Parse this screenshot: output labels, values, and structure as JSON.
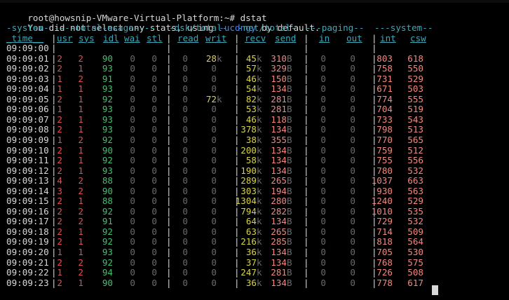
{
  "prompt": {
    "text": "root@howsnip-VMware-Virtual-Platform:~# dstat"
  },
  "notice": {
    "prefix": "You did not select any stats, using ",
    "flag": "-ucdngy",
    "suffix": " by default."
  },
  "group_headers": {
    "system": "-system-",
    "total_usage": "----total-usage----",
    "dsk_total": "-dsk/total-",
    "net_total": "-net/total-",
    "paging": "---paging--",
    "system2": "---system--"
  },
  "columns": {
    "time": "time",
    "usr": "usr",
    "sys": "sys",
    "idl": "idl",
    "wai": "wai",
    "stl": "stl",
    "read": "read",
    "writ": "writ",
    "recv": "recv",
    "send": "send",
    "in": "in",
    "out": "out",
    "int": "int",
    "csw": "csw"
  },
  "rows": [
    {
      "time": "09:09:00",
      "usr": "",
      "sys": "",
      "idl": "",
      "wai": "",
      "stl": "",
      "read": "",
      "writ": "",
      "writ_unit": "",
      "recv": "",
      "recv_unit": "",
      "send": "",
      "send_unit": "",
      "pin": "",
      "pout": "",
      "int": "",
      "csw": ""
    },
    {
      "time": "09:09:01",
      "usr": "2",
      "sys": "2",
      "idl": "90",
      "wai": "0",
      "stl": "0",
      "read": "0",
      "writ": "28",
      "writ_unit": "k",
      "recv": "45",
      "recv_unit": "k",
      "send": "310",
      "send_unit": "B",
      "pin": "0",
      "pout": "0",
      "int": "803",
      "csw": "618"
    },
    {
      "time": "09:09:02",
      "usr": "2",
      "sys": "1",
      "idl": "93",
      "wai": "0",
      "stl": "0",
      "read": "0",
      "writ": "0",
      "writ_unit": "",
      "recv": "57",
      "recv_unit": "k",
      "send": "329",
      "send_unit": "B",
      "pin": "0",
      "pout": "0",
      "int": "758",
      "csw": "550"
    },
    {
      "time": "09:09:03",
      "usr": "1",
      "sys": "2",
      "idl": "91",
      "wai": "0",
      "stl": "0",
      "read": "0",
      "writ": "0",
      "writ_unit": "",
      "recv": "46",
      "recv_unit": "k",
      "send": "150",
      "send_unit": "B",
      "pin": "0",
      "pout": "0",
      "int": "731",
      "csw": "529"
    },
    {
      "time": "09:09:04",
      "usr": "1",
      "sys": "1",
      "idl": "93",
      "wai": "0",
      "stl": "0",
      "read": "0",
      "writ": "0",
      "writ_unit": "",
      "recv": "54",
      "recv_unit": "k",
      "send": "134",
      "send_unit": "B",
      "pin": "0",
      "pout": "0",
      "int": "671",
      "csw": "503"
    },
    {
      "time": "09:09:05",
      "usr": "2",
      "sys": "1",
      "idl": "92",
      "wai": "0",
      "stl": "0",
      "read": "0",
      "writ": "72",
      "writ_unit": "k",
      "recv": "82",
      "recv_unit": "k",
      "send": "281",
      "send_unit": "B",
      "pin": "0",
      "pout": "0",
      "int": "774",
      "csw": "555"
    },
    {
      "time": "09:09:06",
      "usr": "1",
      "sys": "1",
      "idl": "93",
      "wai": "0",
      "stl": "0",
      "read": "0",
      "writ": "0",
      "writ_unit": "",
      "recv": "53",
      "recv_unit": "k",
      "send": "281",
      "send_unit": "B",
      "pin": "0",
      "pout": "0",
      "int": "704",
      "csw": "519"
    },
    {
      "time": "09:09:07",
      "usr": "2",
      "sys": "1",
      "idl": "93",
      "wai": "0",
      "stl": "0",
      "read": "0",
      "writ": "0",
      "writ_unit": "",
      "recv": "46",
      "recv_unit": "k",
      "send": "118",
      "send_unit": "B",
      "pin": "0",
      "pout": "0",
      "int": "733",
      "csw": "543"
    },
    {
      "time": "09:09:08",
      "usr": "2",
      "sys": "1",
      "idl": "93",
      "wai": "0",
      "stl": "0",
      "read": "0",
      "writ": "0",
      "writ_unit": "",
      "recv": "378",
      "recv_unit": "k",
      "send": "134",
      "send_unit": "B",
      "pin": "0",
      "pout": "0",
      "int": "798",
      "csw": "513"
    },
    {
      "time": "09:09:09",
      "usr": "1",
      "sys": "2",
      "idl": "92",
      "wai": "0",
      "stl": "0",
      "read": "0",
      "writ": "0",
      "writ_unit": "",
      "recv": "38",
      "recv_unit": "k",
      "send": "355",
      "send_unit": "B",
      "pin": "0",
      "pout": "0",
      "int": "770",
      "csw": "565"
    },
    {
      "time": "09:09:10",
      "usr": "2",
      "sys": "1",
      "idl": "90",
      "wai": "0",
      "stl": "0",
      "read": "0",
      "writ": "0",
      "writ_unit": "",
      "recv": "200",
      "recv_unit": "k",
      "send": "134",
      "send_unit": "B",
      "pin": "0",
      "pout": "0",
      "int": "759",
      "csw": "512"
    },
    {
      "time": "09:09:11",
      "usr": "2",
      "sys": "1",
      "idl": "92",
      "wai": "0",
      "stl": "0",
      "read": "0",
      "writ": "0",
      "writ_unit": "",
      "recv": "58",
      "recv_unit": "k",
      "send": "134",
      "send_unit": "B",
      "pin": "0",
      "pout": "0",
      "int": "755",
      "csw": "556"
    },
    {
      "time": "09:09:12",
      "usr": "2",
      "sys": "1",
      "idl": "93",
      "wai": "0",
      "stl": "0",
      "read": "0",
      "writ": "0",
      "writ_unit": "",
      "recv": "190",
      "recv_unit": "k",
      "send": "134",
      "send_unit": "B",
      "pin": "0",
      "pout": "0",
      "int": "780",
      "csw": "532"
    },
    {
      "time": "09:09:13",
      "usr": "4",
      "sys": "2",
      "idl": "88",
      "wai": "0",
      "stl": "0",
      "read": "0",
      "writ": "0",
      "writ_unit": "",
      "recv": "289",
      "recv_unit": "k",
      "send": "265",
      "send_unit": "B",
      "pin": "0",
      "pout": "0",
      "int": "1037",
      "csw": "663"
    },
    {
      "time": "09:09:14",
      "usr": "3",
      "sys": "2",
      "idl": "90",
      "wai": "0",
      "stl": "0",
      "read": "0",
      "writ": "0",
      "writ_unit": "",
      "recv": "303",
      "recv_unit": "k",
      "send": "194",
      "send_unit": "B",
      "pin": "0",
      "pout": "0",
      "int": "930",
      "csw": "563"
    },
    {
      "time": "09:09:15",
      "usr": "2",
      "sys": "1",
      "idl": "88",
      "wai": "0",
      "stl": "0",
      "read": "0",
      "writ": "0",
      "writ_unit": "",
      "recv": "1304",
      "recv_unit": "k",
      "send": "280",
      "send_unit": "B",
      "pin": "0",
      "pout": "0",
      "int": "1240",
      "csw": "529"
    },
    {
      "time": "09:09:16",
      "usr": "2",
      "sys": "2",
      "idl": "92",
      "wai": "0",
      "stl": "0",
      "read": "0",
      "writ": "0",
      "writ_unit": "",
      "recv": "794",
      "recv_unit": "k",
      "send": "282",
      "send_unit": "B",
      "pin": "0",
      "pout": "0",
      "int": "1010",
      "csw": "535"
    },
    {
      "time": "09:09:17",
      "usr": "2",
      "sys": "2",
      "idl": "91",
      "wai": "0",
      "stl": "0",
      "read": "0",
      "writ": "0",
      "writ_unit": "",
      "recv": "64",
      "recv_unit": "k",
      "send": "134",
      "send_unit": "B",
      "pin": "0",
      "pout": "0",
      "int": "729",
      "csw": "532"
    },
    {
      "time": "09:09:18",
      "usr": "2",
      "sys": "1",
      "idl": "92",
      "wai": "0",
      "stl": "0",
      "read": "0",
      "writ": "0",
      "writ_unit": "",
      "recv": "63",
      "recv_unit": "k",
      "send": "265",
      "send_unit": "B",
      "pin": "0",
      "pout": "0",
      "int": "714",
      "csw": "509"
    },
    {
      "time": "09:09:19",
      "usr": "2",
      "sys": "1",
      "idl": "92",
      "wai": "0",
      "stl": "0",
      "read": "0",
      "writ": "0",
      "writ_unit": "",
      "recv": "216",
      "recv_unit": "k",
      "send": "285",
      "send_unit": "B",
      "pin": "0",
      "pout": "0",
      "int": "818",
      "csw": "564"
    },
    {
      "time": "09:09:20",
      "usr": "1",
      "sys": "1",
      "idl": "93",
      "wai": "0",
      "stl": "0",
      "read": "0",
      "writ": "0",
      "writ_unit": "",
      "recv": "36",
      "recv_unit": "k",
      "send": "134",
      "send_unit": "B",
      "pin": "0",
      "pout": "0",
      "int": "705",
      "csw": "530"
    },
    {
      "time": "09:09:21",
      "usr": "2",
      "sys": "2",
      "idl": "92",
      "wai": "0",
      "stl": "0",
      "read": "0",
      "writ": "0",
      "writ_unit": "",
      "recv": "37",
      "recv_unit": "k",
      "send": "134",
      "send_unit": "B",
      "pin": "0",
      "pout": "0",
      "int": "768",
      "csw": "575"
    },
    {
      "time": "09:09:22",
      "usr": "1",
      "sys": "2",
      "idl": "94",
      "wai": "0",
      "stl": "0",
      "read": "0",
      "writ": "0",
      "writ_unit": "",
      "recv": "247",
      "recv_unit": "k",
      "send": "281",
      "send_unit": "B",
      "pin": "0",
      "pout": "0",
      "int": "726",
      "csw": "508"
    },
    {
      "time": "09:09:23",
      "usr": "2",
      "sys": "1",
      "idl": "90",
      "wai": "0",
      "stl": "0",
      "read": "0",
      "writ": "0",
      "writ_unit": "",
      "recv": "36",
      "recv_unit": "k",
      "send": "134",
      "send_unit": "B",
      "pin": "0",
      "pout": "0",
      "int": "778",
      "csw": "617"
    }
  ],
  "colors": {
    "background": "#000000",
    "text": "#d8d8d8",
    "header": "#3fa7b8",
    "flag": "#4a7ef0",
    "cpu": "#3fc06e",
    "cpu_high": "#e05050",
    "net": "#d8d24a",
    "zero": "#6b6b6b",
    "system": "#f08a80"
  }
}
